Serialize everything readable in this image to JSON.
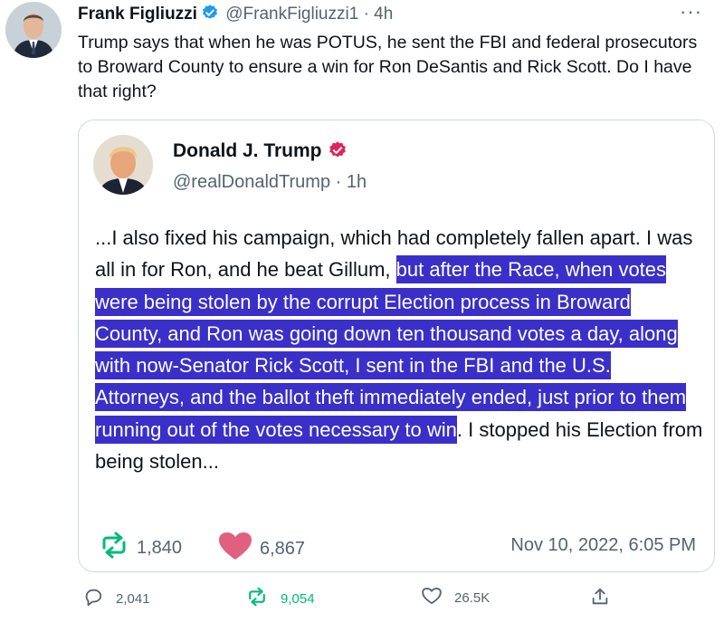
{
  "tweet": {
    "author_name": "Frank Figliuzzi",
    "author_handle": "@FrankFigliuzzi1",
    "separator": "·",
    "time": "4h",
    "more_label": "···",
    "text": "Trump says that when he was POTUS, he sent the FBI and federal prosecutors to Broward County to ensure a win for Ron DeSantis and Rick Scott. Do I have that right?",
    "verified": true
  },
  "quoted": {
    "author_name": "Donald J. Trump",
    "author_handle": "@realDonaldTrump",
    "separator": "·",
    "time": "1h",
    "verified": true,
    "text_before": "...I also fixed his campaign, which had completely fallen apart. I was all in for Ron, and he beat Gillum, ",
    "text_highlighted": "but after the Race, when votes were being stolen by the corrupt Election process in Broward County, and Ron was going down ten thousand votes a day, along with now-Senator Rick Scott, I sent in the FBI and the U.S. Attorneys, and the ballot theft immediately ended, just prior to them running out of the votes necessary to win",
    "text_after": ". I stopped his Election from being stolen...",
    "retweets": "1,840",
    "likes": "6,867",
    "date": "Nov 10, 2022, 6:05 PM"
  },
  "actions": {
    "replies": "2,041",
    "retweets": "9,054",
    "likes": "26.5K"
  },
  "colors": {
    "verified_blue": "#1d9bf0",
    "verified_gold": "#e0245e",
    "highlight": "#3a2fc8",
    "retweet_green": "#00ba7c",
    "like_pink": "#e0617f",
    "muted": "#536471"
  },
  "icons": [
    "verified-badge-icon",
    "more-icon",
    "retweet-icon",
    "heart-icon",
    "reply-icon",
    "like-icon",
    "share-icon"
  ]
}
